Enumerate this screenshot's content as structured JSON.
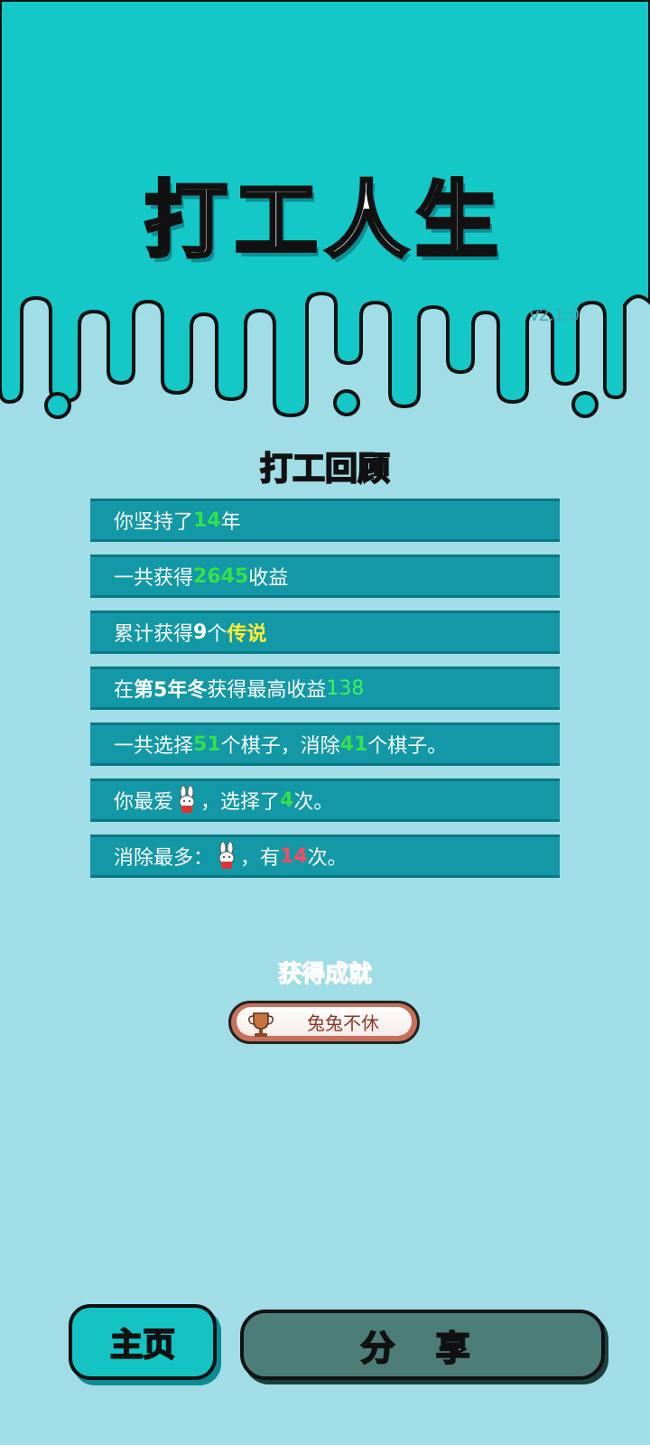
{
  "header": {
    "title": "打工人生",
    "version": "v2.1.0"
  },
  "review": {
    "title": "打工回顾",
    "rows": [
      {
        "a": "你坚持了",
        "b": "14",
        "c": "年"
      },
      {
        "a": "一共获得",
        "b": "2645",
        "c": "收益"
      },
      {
        "a": "累计获得",
        "b": "9",
        "c": "个",
        "d": "传说"
      },
      {
        "a": "在 ",
        "b": "第5年冬",
        "c": " 获得最高收益",
        "d": "138"
      },
      {
        "a": "一共选择",
        "b": "51",
        "c": "个棋子，消除",
        "d": "41",
        "e": "个棋子。"
      },
      {
        "a": "你最爱",
        "c": "，选择了",
        "d": "4",
        "e": "次。"
      },
      {
        "a": "消除最多：",
        "c": "，有",
        "d": "14",
        "e": "次。"
      }
    ]
  },
  "achievement": {
    "title": "获得成就",
    "badge_label": "兔兔不休"
  },
  "buttons": {
    "home": "主页",
    "share": "分 享"
  },
  "colors": {
    "top_band": "#14c8c8",
    "background": "#a0dde6",
    "row": "#1298a6"
  }
}
